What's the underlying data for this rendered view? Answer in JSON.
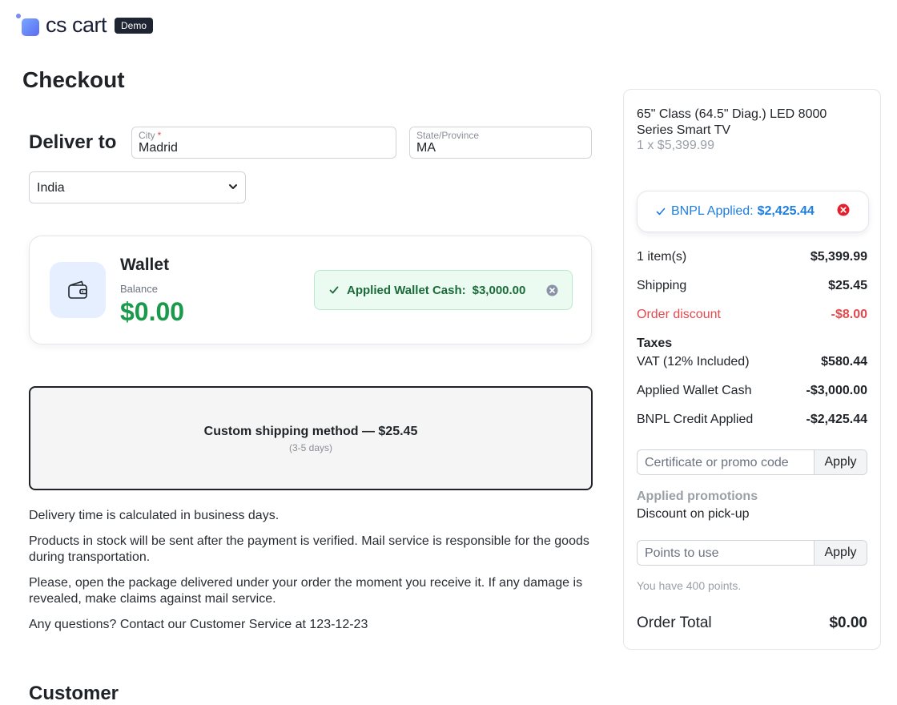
{
  "header": {
    "logo_text": "cs cart",
    "badge": "Demo"
  },
  "page": {
    "title": "Checkout"
  },
  "deliver": {
    "label": "Deliver to",
    "city_label": "City",
    "city_required": "*",
    "city_value": "Madrid",
    "state_label": "State/Province",
    "state_value": "MA",
    "country_value": "India"
  },
  "wallet": {
    "title": "Wallet",
    "balance_label": "Balance",
    "balance": "$0.00",
    "applied_label": "Applied Wallet Cash:",
    "applied_amount": "$3,000.00"
  },
  "shipping": {
    "method": "Custom shipping method — $25.45",
    "days": "(3-5 days)"
  },
  "info": {
    "line1": "Delivery time is calculated in business days.",
    "line2": "Products in stock will be sent after the payment is verified. Mail service is responsible for the goods during transportation.",
    "line3": "Please, open the package delivered under your order the moment you receive it. If any damage is revealed, make claims against mail service.",
    "line4": "Any questions? Contact our Customer Service at 123-12-23"
  },
  "customer": {
    "heading": "Customer"
  },
  "summary": {
    "product_name": "65\" Class (64.5\" Diag.) LED 8000 Series Smart TV",
    "product_qty": "1 x $5,399.99",
    "bnpl_label": "BNPL Applied:",
    "bnpl_amount": "$2,425.44",
    "items_label": "1 item(s)",
    "items_value": "$5,399.99",
    "shipping_label": "Shipping",
    "shipping_value": "$25.45",
    "discount_label": "Order discount",
    "discount_value": "-$8.00",
    "taxes_label": "Taxes",
    "vat_label": "VAT (12% Included)",
    "vat_value": "$580.44",
    "wallet_label": "Applied Wallet Cash",
    "wallet_value": "-$3,000.00",
    "bnpl_credit_label": "BNPL Credit Applied",
    "bnpl_credit_value": "-$2,425.44",
    "promo_placeholder": "Certificate or promo code",
    "apply_label": "Apply",
    "applied_promos_title": "Applied promotions",
    "applied_promos_item": "Discount on pick-up",
    "points_placeholder": "Points to use",
    "points_apply_label": "Apply",
    "points_note": "You have 400 points.",
    "total_label": "Order Total",
    "total_value": "$0.00"
  },
  "colors": {
    "wallet_green": "#1a9a4a",
    "bnpl_blue": "#1f7fe0",
    "discount_red": "#e5484d",
    "close_red": "#e5202e"
  },
  "icons": {
    "logo": "cscart-logo-icon",
    "wallet": "wallet-icon",
    "check": "check-icon",
    "close": "close-circle-icon",
    "chevron": "chevron-down-icon"
  }
}
